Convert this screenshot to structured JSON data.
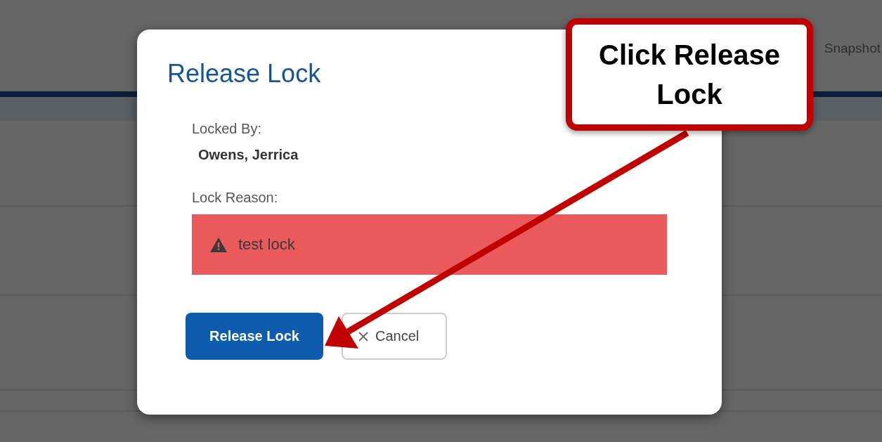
{
  "background_page": {
    "header_text": "Snapshot"
  },
  "dialog": {
    "title": "Release Lock",
    "locked_by": {
      "label": "Locked By:",
      "value": "Owens, Jerrica"
    },
    "lock_reason": {
      "label": "Lock Reason:",
      "text": "test lock"
    },
    "buttons": [
      {
        "label": "Release Lock",
        "kind": "primary"
      },
      {
        "label": "Cancel",
        "kind": "secondary"
      }
    ]
  },
  "callout": {
    "text": "Click Release Lock"
  }
}
